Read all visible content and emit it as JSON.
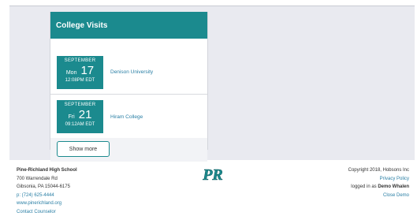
{
  "college_visits": {
    "title": "College Visits",
    "visits": [
      {
        "month": "SEPTEMBER",
        "weekday": "Mon",
        "day": "17",
        "time": "12:08PM EDT",
        "college": "Denison University"
      },
      {
        "month": "SEPTEMBER",
        "weekday": "Fri",
        "day": "21",
        "time": "09:12AM EDT",
        "college": "Hiram College"
      }
    ],
    "show_more_label": "Show more"
  },
  "footer": {
    "school_name": "Pine-Richland High School",
    "address_line1": "700 Warrendale Rd",
    "address_line2": "Gibsonia, PA 15044-6175",
    "phone": "p: (724) 625-4444",
    "website": "www.pinerichland.org",
    "contact_label": "Contact Counselor",
    "logo_text": "PR",
    "copyright": "Copyright 2018, Hobsons Inc",
    "privacy_label": "Privacy Policy",
    "logged_in_prefix": "logged in as",
    "logged_in_user": "Demo Whalen",
    "close_demo_label": "Close Demo"
  },
  "colors": {
    "teal": "#1b8a8e",
    "link": "#2a7fa5",
    "background_gray": "#e9eaf0"
  }
}
